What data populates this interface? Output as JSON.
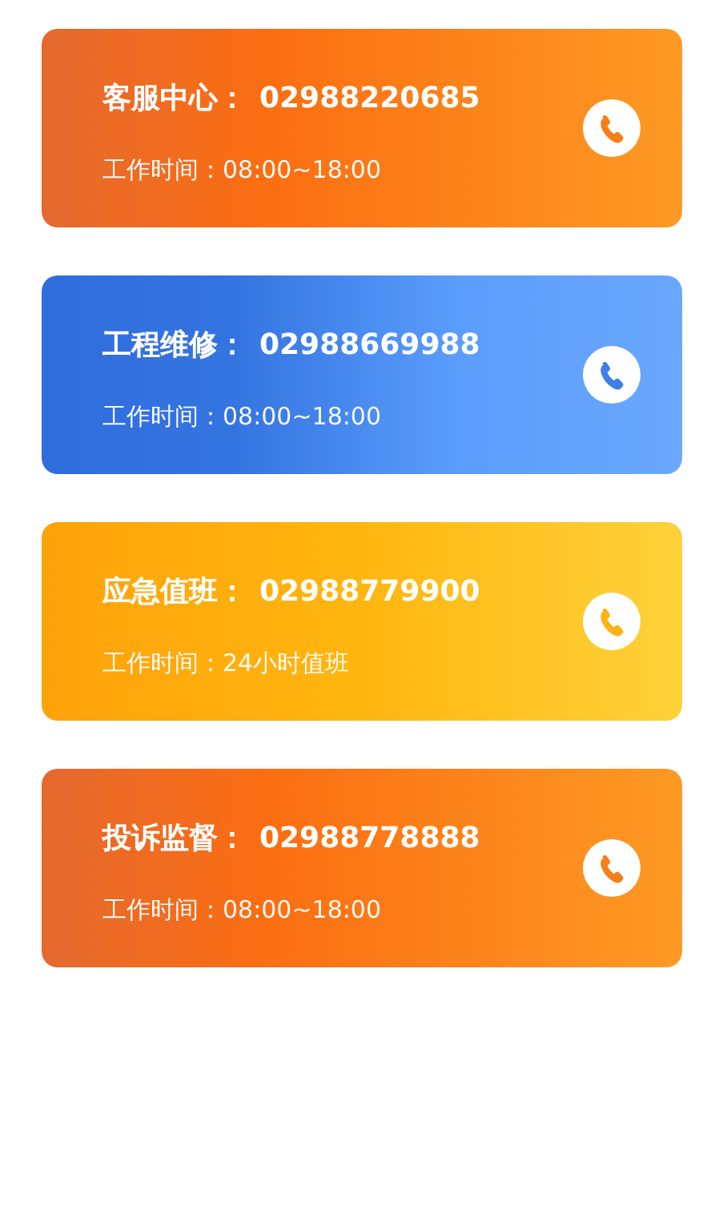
{
  "contacts": [
    {
      "kind": "orange",
      "name": "客服中心：",
      "phone": "02988220685",
      "hours": "工作时间：08:00~18:00"
    },
    {
      "kind": "blue",
      "name": "工程维修：",
      "phone": "02988669988",
      "hours": "工作时间：08:00~18:00"
    },
    {
      "kind": "yellow",
      "name": "应急值班：",
      "phone": "02988779900",
      "hours": "工作时间：24小时值班"
    },
    {
      "kind": "orange",
      "name": "投诉监督：",
      "phone": "02988778888",
      "hours": "工作时间：08:00~18:00"
    }
  ]
}
